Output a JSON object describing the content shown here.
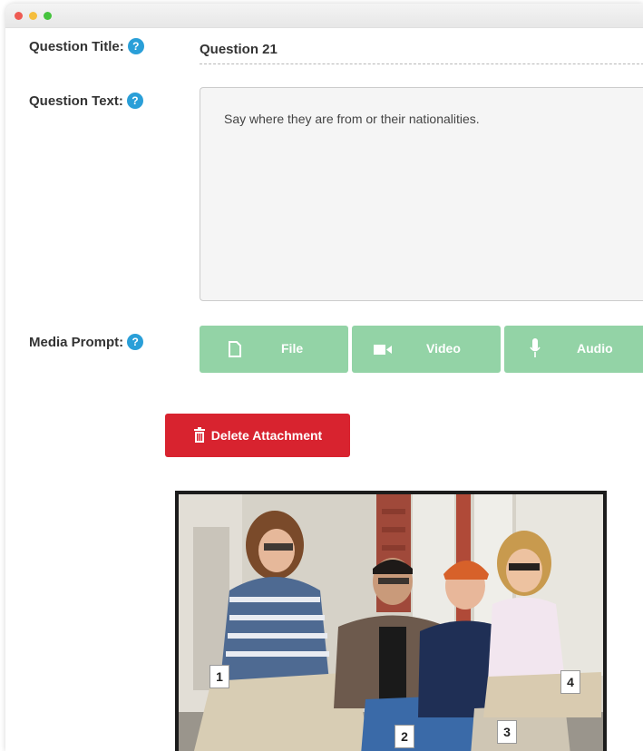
{
  "form": {
    "question_title_label": "Question Title:",
    "question_title_value": "Question 21",
    "question_text_label": "Question Text:",
    "question_text_value": "Say where they are from or their nationalities.",
    "media_prompt_label": "Media Prompt:",
    "help_icon": "?"
  },
  "media_buttons": {
    "file": "File",
    "video": "Video",
    "audio": "Audio"
  },
  "delete_button": "Delete Attachment",
  "photo_labels": [
    "1",
    "2",
    "3",
    "4"
  ],
  "colors": {
    "help": "#2a9fd8",
    "media_button": "#93d3a6",
    "delete_button": "#d8232f"
  }
}
